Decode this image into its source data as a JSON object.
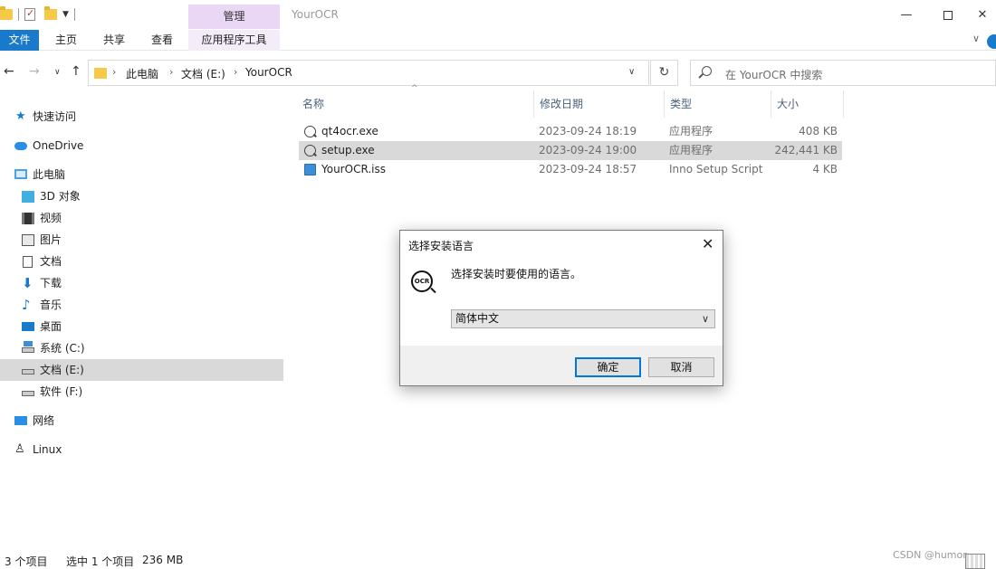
{
  "window": {
    "title": "YourOCR",
    "manage_tab": "管理",
    "minimize_glyph": "—",
    "close_glyph": "✕"
  },
  "ribbon": {
    "file": "文件",
    "home": "主页",
    "share": "共享",
    "view": "查看",
    "app_tools": "应用程序工具"
  },
  "address": {
    "crumbs": [
      "此电脑",
      "文档 (E:)",
      "YourOCR"
    ],
    "search_placeholder": "在 YourOCR 中搜索"
  },
  "sidebar": {
    "items": [
      {
        "label": "快速访问",
        "icon": "star-icon"
      },
      {
        "label": "OneDrive",
        "icon": "cloud-icon"
      },
      {
        "label": "此电脑",
        "icon": "computer-icon"
      },
      {
        "label": "3D 对象",
        "icon": "cube-icon"
      },
      {
        "label": "视频",
        "icon": "film-icon"
      },
      {
        "label": "图片",
        "icon": "picture-icon"
      },
      {
        "label": "文档",
        "icon": "document-icon"
      },
      {
        "label": "下载",
        "icon": "download-icon"
      },
      {
        "label": "音乐",
        "icon": "music-icon"
      },
      {
        "label": "桌面",
        "icon": "desktop-icon"
      },
      {
        "label": "系统 (C:)",
        "icon": "drive-icon"
      },
      {
        "label": "文档 (E:)",
        "icon": "drive-icon",
        "selected": true
      },
      {
        "label": "软件 (F:)",
        "icon": "drive-icon"
      },
      {
        "label": "网络",
        "icon": "network-icon"
      },
      {
        "label": "Linux",
        "icon": "linux-icon"
      }
    ]
  },
  "file_list": {
    "columns": [
      "名称",
      "修改日期",
      "类型",
      "大小"
    ],
    "rows": [
      {
        "name": "qt4ocr.exe",
        "date": "2023-09-24 18:19",
        "type": "应用程序",
        "size": "408 KB"
      },
      {
        "name": "setup.exe",
        "date": "2023-09-24 19:00",
        "type": "应用程序",
        "size": "242,441 KB",
        "selected": true
      },
      {
        "name": "YourOCR.iss",
        "date": "2023-09-24 18:57",
        "type": "Inno Setup Script",
        "size": "4 KB"
      }
    ]
  },
  "status": {
    "count": "3 个项目",
    "selection": "选中 1 个项目",
    "size": "236 MB",
    "watermark": "CSDN @humor"
  },
  "dialog": {
    "title": "选择安装语言",
    "close_glyph": "✕",
    "logo_text": "OCR",
    "prompt": "选择安装时要使用的语言。",
    "selected_language": "简体中文",
    "ok": "确定",
    "cancel": "取消"
  }
}
